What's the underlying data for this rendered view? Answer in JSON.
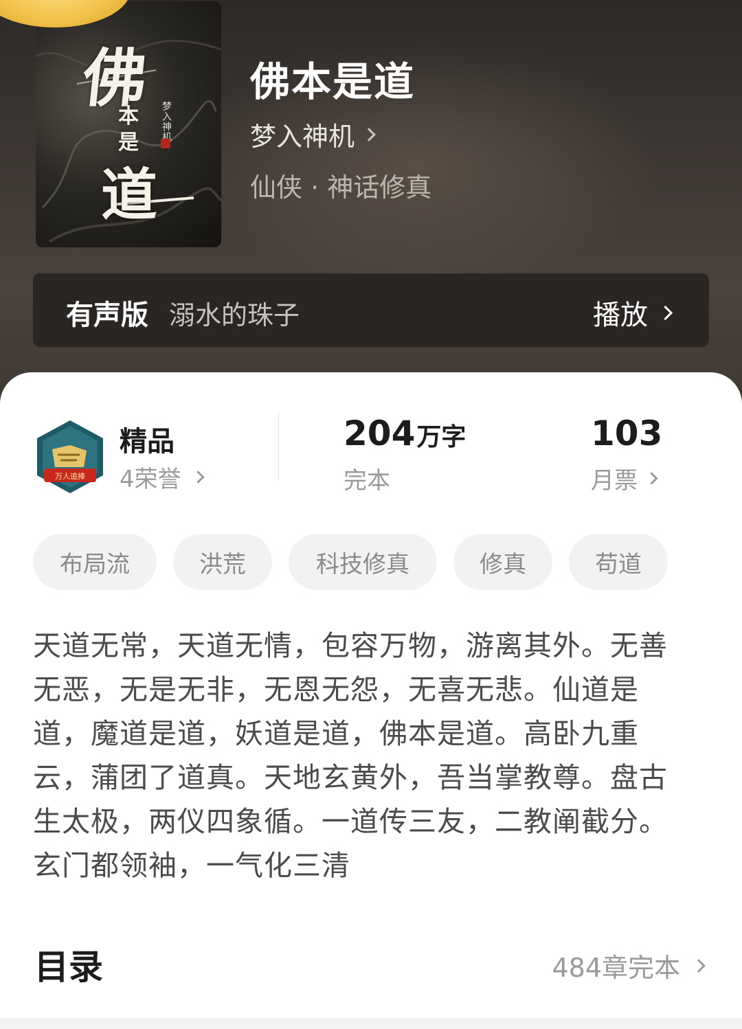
{
  "book": {
    "cover": {
      "title_big": "佛",
      "title_small_1": "本",
      "title_small_2": "是",
      "title_big_2": "道",
      "author_vertical": "梦入神机"
    },
    "title": "佛本是道",
    "author": "梦入神机",
    "genre": "仙侠 · 神话修真"
  },
  "audio": {
    "label": "有声版",
    "narrator": "溺水的珠子",
    "play_label": "播放"
  },
  "stats": {
    "rank_title": "精品",
    "honors": "4荣誉",
    "badge_text": "万人追捧",
    "word_count_num": "204",
    "word_count_unit": "万字",
    "status": "完本",
    "monthly_votes": "103",
    "monthly_votes_label": "月票"
  },
  "tags": [
    "布局流",
    "洪荒",
    "科技修真",
    "修真",
    "苟道"
  ],
  "description": "天道无常，天道无情，包容万物，游离其外。无善无恶，无是无非，无恩无怨，无喜无悲。仙道是道，魔道是道，妖道是道，佛本是道。高卧九重云，蒲团了道真。天地玄黄外，吾当掌教尊。盘古生太极，两仪四象循。一道传三友，二教阐截分。玄门都领袖，一气化三清",
  "toc": {
    "title": "目录",
    "meta": "484章完本"
  },
  "colors": {
    "accent_gold": "#f2c24a",
    "badge_teal": "#1f5b66",
    "badge_red": "#c8281e"
  }
}
